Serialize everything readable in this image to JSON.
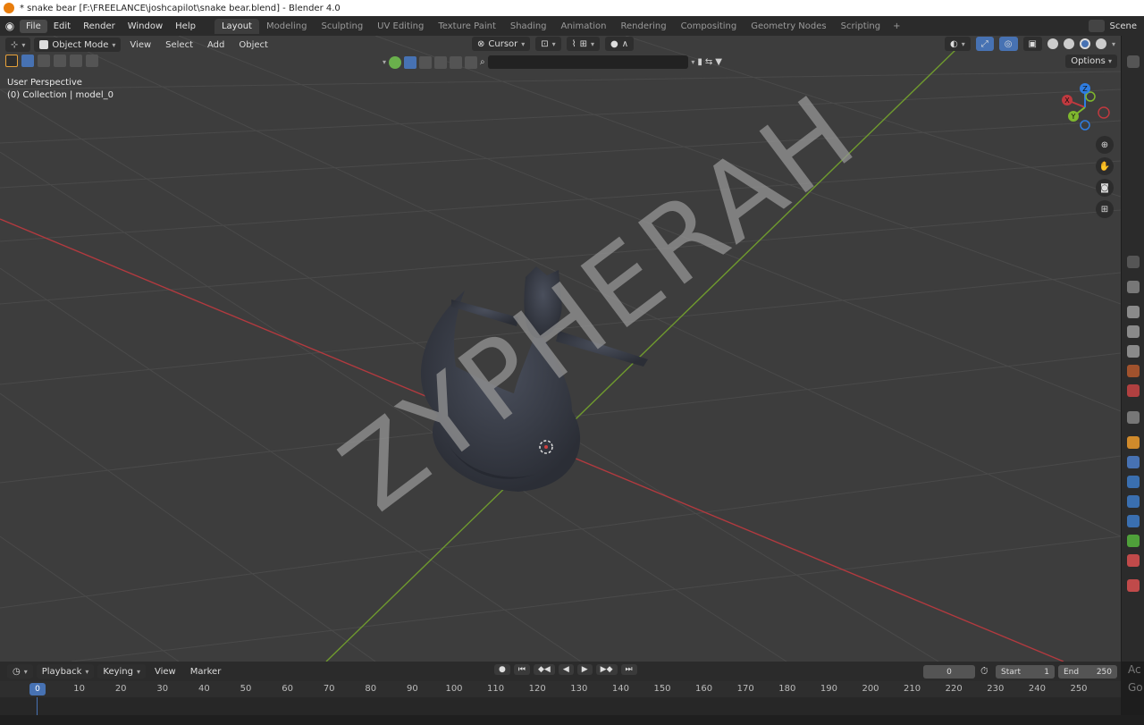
{
  "window_title": "* snake bear [F:\\FREELANCE\\joshcapilot\\snake bear.blend] - Blender 4.0",
  "menu": [
    "File",
    "Edit",
    "Render",
    "Window",
    "Help"
  ],
  "workspaces": [
    "Layout",
    "Modeling",
    "Sculpting",
    "UV Editing",
    "Texture Paint",
    "Shading",
    "Animation",
    "Rendering",
    "Compositing",
    "Geometry Nodes",
    "Scripting"
  ],
  "active_workspace": "Layout",
  "scene_label": "Scene",
  "viewport": {
    "mode": "Object Mode",
    "menus": [
      "View",
      "Select",
      "Add",
      "Object"
    ],
    "transform_pivot": "Cursor",
    "options_label": "Options",
    "view_name": "User Perspective",
    "collection_info": "(0) Collection | model_0",
    "gizmo_axes": {
      "x": "X",
      "y": "Y",
      "z": "Z"
    },
    "watermark": "ZYPHERAH"
  },
  "timeline": {
    "menus": [
      "Playback",
      "Keying",
      "View",
      "Marker"
    ],
    "current_frame": "0",
    "start_label": "Start",
    "start_value": "1",
    "end_label": "End",
    "end_value": "250",
    "ruler_ticks": [
      "0",
      "10",
      "20",
      "30",
      "40",
      "50",
      "60",
      "70",
      "80",
      "90",
      "100",
      "110",
      "120",
      "130",
      "140",
      "150",
      "160",
      "170",
      "180",
      "190",
      "200",
      "210",
      "220",
      "230",
      "240",
      "250"
    ]
  },
  "side_notes": [
    "Ac",
    "Go"
  ],
  "colors": {
    "accent": "#4772b3",
    "x_axis": "#c0393f",
    "y_axis": "#7fb82e",
    "z_axis": "#2f7de1",
    "viewport_bg": "#3d3d3d"
  }
}
